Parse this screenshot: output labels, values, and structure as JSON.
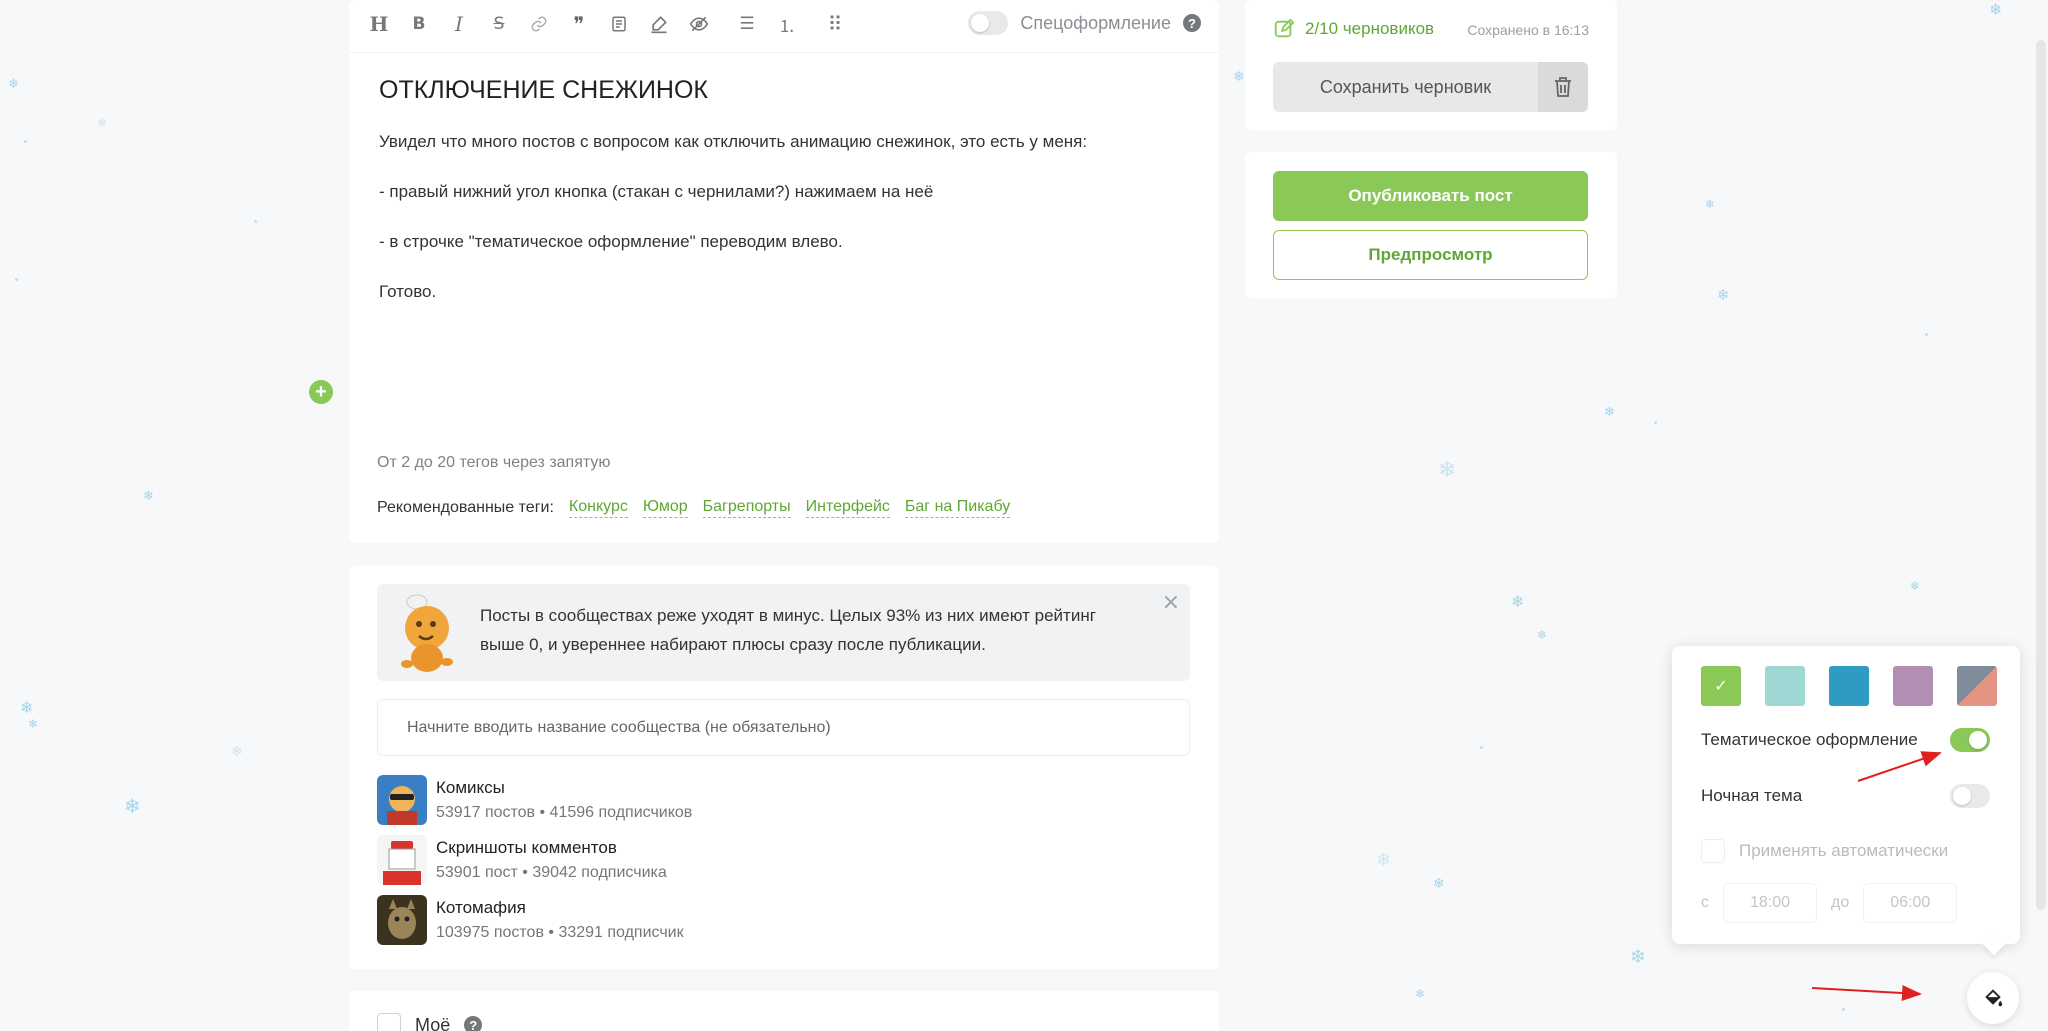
{
  "toolbar": {
    "icons": [
      "heading-icon",
      "bold-icon",
      "italic-icon",
      "strikethrough-icon",
      "link-icon",
      "quote-icon",
      "paragraph-icon",
      "highlight-icon",
      "spoiler-icon",
      "bulleted-list-icon",
      "numbered-list-icon",
      "drag-icon"
    ],
    "glyphs": {
      "heading": "H",
      "bold": "B",
      "italic": "I",
      "strike": "S",
      "quote": "❞",
      "list": "☰",
      "olist": "⒈",
      "drag": "⠿"
    },
    "spec_label": "Спецоформление",
    "help": "?"
  },
  "post": {
    "title": "ОТКЛЮЧЕНИЕ СНЕЖИНОК",
    "paragraphs": [
      "Увидел что много постов с вопросом как отключить анимацию снежинок, это есть у меня:",
      "- правый нижний угол кнопка (стакан с чернилами?) нажимаем на неё",
      "- в строчке \"тематическое оформление\"  переводим влево.",
      "Готово."
    ],
    "add_block": "+"
  },
  "tags": {
    "hint": "От 2 до 20 тегов через запятую",
    "recommended_label": "Рекомендованные теги:",
    "recommended": [
      "Конкурс",
      "Юмор",
      "Багрепорты",
      "Интерфейс",
      "Баг на Пикабу"
    ]
  },
  "community": {
    "banner_text": "Посты в сообществах реже уходят в минус. Целых 93% из них имеют рейтинг выше 0, и увереннее набирают плюсы сразу после публикации.",
    "close": "×",
    "input_placeholder": "Начните вводить название сообщества (не обязательно)",
    "items": [
      {
        "name": "Комиксы",
        "stats": "53917 постов • 41596 подписчиков"
      },
      {
        "name": "Скриншоты комментов",
        "stats": "53901 пост • 39042 подписчика"
      },
      {
        "name": "Котомафия",
        "stats": "103975 постов • 33291 подписчик"
      }
    ]
  },
  "bottom": {
    "moe_label": "Моё",
    "help": "?"
  },
  "drafts": {
    "count": "2/10 черновиков",
    "saved_at": "Сохранено в 16:13",
    "save_label": "Сохранить черновик"
  },
  "publish": {
    "publish_label": "Опубликовать пост",
    "preview_label": "Предпросмотр"
  },
  "theme_popup": {
    "swatches": [
      "#8ac858",
      "#9fd7d4",
      "#2e9bc4",
      "#b38fb6",
      "split"
    ],
    "selected_mark": "✓",
    "thematic_label": "Тематическое оформление",
    "thematic_on": true,
    "night_label": "Ночная тема",
    "night_on": false,
    "auto_label": "Применять автоматически",
    "from_label": "с",
    "from_time": "18:00",
    "to_label": "до",
    "to_time": "06:00"
  },
  "colors": {
    "accent": "#8ac858",
    "accent_text": "#5fa735",
    "annotation_arrow": "#e02020",
    "snowflake": "#a9d4ea"
  },
  "snow_glyph": "❄"
}
